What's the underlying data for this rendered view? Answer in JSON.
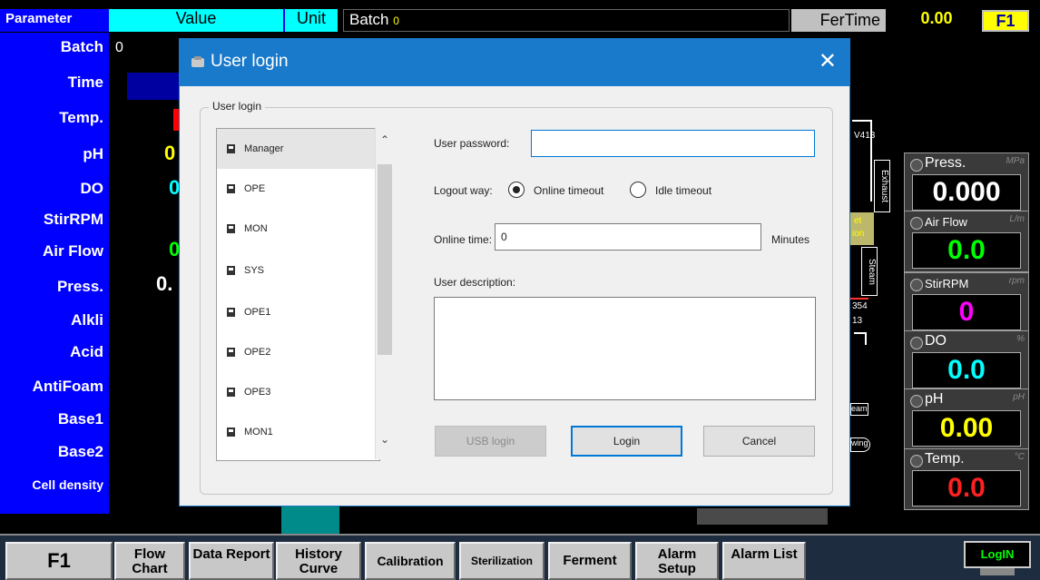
{
  "header": {
    "param_col": "Parameter",
    "value_col": "Value",
    "unit_col": "Unit",
    "batch_label": "Batch",
    "batch_value": "0",
    "fertime_label": "FerTime",
    "fertime_value": "0.00",
    "f1": "F1"
  },
  "params": [
    {
      "label": "Batch",
      "value": "0"
    },
    {
      "label": "Time",
      "value": ""
    },
    {
      "label": "Temp.",
      "value": ""
    },
    {
      "label": "pH",
      "value": "0"
    },
    {
      "label": "DO",
      "value": "0"
    },
    {
      "label": "StirRPM",
      "value": ""
    },
    {
      "label": "Air Flow",
      "value": "0"
    },
    {
      "label": "Press.",
      "value": "0."
    },
    {
      "label": "Alkli",
      "value": ""
    },
    {
      "label": "Acid",
      "value": ""
    },
    {
      "label": "AntiFoam",
      "value": ""
    },
    {
      "label": "Base1",
      "value": ""
    },
    {
      "label": "Base2",
      "value": ""
    },
    {
      "label": "Cell density",
      "value": ""
    }
  ],
  "gauges": [
    {
      "name": "Press.",
      "unit": "MPa",
      "value": "0.000",
      "color": "#ffffff"
    },
    {
      "name": "Air Flow",
      "unit": "L/m",
      "value": "0.0",
      "color": "#00ff00"
    },
    {
      "name": "StirRPM",
      "unit": "rpm",
      "value": "0",
      "color": "#ff00ff"
    },
    {
      "name": "DO",
      "unit": "%",
      "value": "0.0",
      "color": "#00ffff"
    },
    {
      "name": "pH",
      "unit": "pH",
      "value": "0.00",
      "color": "#ffff00"
    },
    {
      "name": "Temp.",
      "unit": "°C",
      "value": "0.0",
      "color": "#ff2020"
    }
  ],
  "process_fragments": {
    "v413": "V413",
    "exhaust": "Exhaust",
    "et": "et",
    "ion": "ion",
    "steam": "Steam",
    "n354": "354",
    "n13": "13",
    "eam": "eam",
    "wing": "wing"
  },
  "toolbar": [
    {
      "label": "F1"
    },
    {
      "label": "Flow Chart"
    },
    {
      "label": "Data Report"
    },
    {
      "label": "History Curve"
    },
    {
      "label": "Calibration"
    },
    {
      "label": "Sterilization"
    },
    {
      "label": "Ferment"
    },
    {
      "label": "Alarm Setup"
    },
    {
      "label": "Alarm List"
    }
  ],
  "login_button": "LogIN",
  "dialog": {
    "title": "User login",
    "group_label": "User login",
    "users": [
      "Manager",
      "OPE",
      "MON",
      "SYS",
      "OPE1",
      "OPE2",
      "OPE3",
      "MON1"
    ],
    "selected_user": "Manager",
    "password_label": "User password:",
    "password_value": "",
    "logout_label": "Logout way:",
    "logout_options": [
      "Online timeout",
      "Idle timeout"
    ],
    "logout_selected": "Online timeout",
    "online_time_label": "Online time:",
    "online_time_value": "0",
    "online_time_unit": "Minutes",
    "description_label": "User description:",
    "description_value": "",
    "usb_login": "USB login",
    "login": "Login",
    "cancel": "Cancel"
  },
  "colors": {
    "param_blue": "#0000ff",
    "header_cyan": "#00ffff",
    "dialog_blue": "#1979ca",
    "value_yellow": "#ffff00"
  }
}
